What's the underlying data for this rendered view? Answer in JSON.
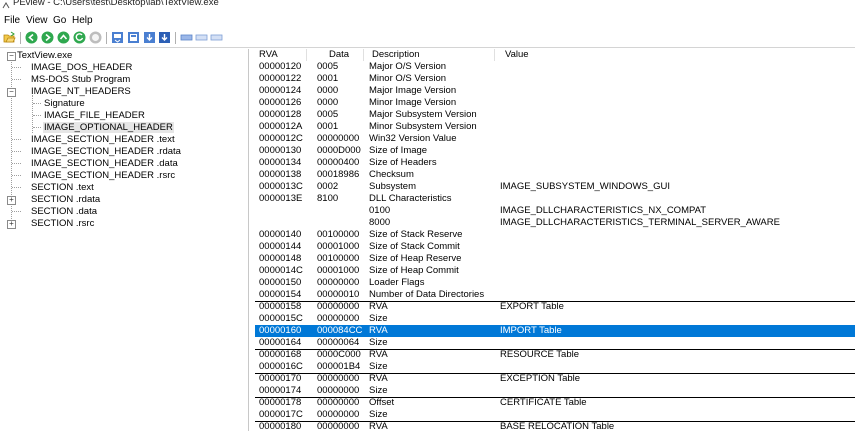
{
  "window": {
    "title": "PEview - C:\\Users\\test\\Desktop\\lab\\TextView.exe"
  },
  "menu": [
    "File",
    "View",
    "Go",
    "Help"
  ],
  "toolbar": {
    "icons": [
      "open-folder-icon",
      "back-icon",
      "forward-icon",
      "up-icon",
      "refresh-icon",
      "stop-icon",
      "view-data-icon",
      "view-hex-icon",
      "view-save-icon",
      "view-struct-icon",
      "layout-single-icon",
      "layout-double-icon",
      "layout-triple-icon"
    ]
  },
  "tree": {
    "root": "TextView.exe",
    "items": [
      {
        "label": "IMAGE_DOS_HEADER",
        "level": 1
      },
      {
        "label": "MS-DOS Stub Program",
        "level": 1
      },
      {
        "label": "IMAGE_NT_HEADERS",
        "level": 1,
        "expander": "-"
      },
      {
        "label": "Signature",
        "level": 2
      },
      {
        "label": "IMAGE_FILE_HEADER",
        "level": 2
      },
      {
        "label": "IMAGE_OPTIONAL_HEADER",
        "level": 2,
        "selected": true
      },
      {
        "label": "IMAGE_SECTION_HEADER .text",
        "level": 1
      },
      {
        "label": "IMAGE_SECTION_HEADER .rdata",
        "level": 1
      },
      {
        "label": "IMAGE_SECTION_HEADER .data",
        "level": 1
      },
      {
        "label": "IMAGE_SECTION_HEADER .rsrc",
        "level": 1
      },
      {
        "label": "SECTION .text",
        "level": 1
      },
      {
        "label": "SECTION .rdata",
        "level": 1,
        "expander": "+"
      },
      {
        "label": "SECTION .data",
        "level": 1
      },
      {
        "label": "SECTION .rsrc",
        "level": 1,
        "expander": "+"
      }
    ]
  },
  "table": {
    "headers": [
      "RVA",
      "Data",
      "Description",
      "Value"
    ],
    "rows": [
      [
        "00000120",
        "0005",
        "Major O/S Version",
        ""
      ],
      [
        "00000122",
        "0001",
        "Minor O/S Version",
        ""
      ],
      [
        "00000124",
        "0000",
        "Major Image Version",
        ""
      ],
      [
        "00000126",
        "0000",
        "Minor Image Version",
        ""
      ],
      [
        "00000128",
        "0005",
        "Major Subsystem Version",
        ""
      ],
      [
        "0000012A",
        "0001",
        "Minor Subsystem Version",
        ""
      ],
      [
        "0000012C",
        "00000000",
        "Win32 Version Value",
        ""
      ],
      [
        "00000130",
        "0000D000",
        "Size of Image",
        ""
      ],
      [
        "00000134",
        "00000400",
        "Size of Headers",
        ""
      ],
      [
        "00000138",
        "00018986",
        "Checksum",
        ""
      ],
      [
        "0000013C",
        "0002",
        "Subsystem",
        "IMAGE_SUBSYSTEM_WINDOWS_GUI"
      ],
      [
        "0000013E",
        "8100",
        "DLL Characteristics",
        ""
      ],
      [
        "",
        "",
        "0100",
        "IMAGE_DLLCHARACTERISTICS_NX_COMPAT"
      ],
      [
        "",
        "",
        "8000",
        "IMAGE_DLLCHARACTERISTICS_TERMINAL_SERVER_AWARE"
      ],
      [
        "00000140",
        "00100000",
        "Size of Stack Reserve",
        ""
      ],
      [
        "00000144",
        "00001000",
        "Size of Stack Commit",
        ""
      ],
      [
        "00000148",
        "00100000",
        "Size of Heap Reserve",
        ""
      ],
      [
        "0000014C",
        "00001000",
        "Size of Heap Commit",
        ""
      ],
      [
        "00000150",
        "00000000",
        "Loader Flags",
        ""
      ],
      [
        "00000154",
        "00000010",
        "Number of Data Directories",
        ""
      ],
      [
        "00000158",
        "00000000",
        "RVA",
        "EXPORT Table"
      ],
      [
        "0000015C",
        "00000000",
        "Size",
        ""
      ],
      [
        "00000160",
        "000084CC",
        "RVA",
        "IMPORT Table"
      ],
      [
        "00000164",
        "00000064",
        "Size",
        ""
      ],
      [
        "00000168",
        "0000C000",
        "RVA",
        "RESOURCE Table"
      ],
      [
        "0000016C",
        "000001B4",
        "Size",
        ""
      ],
      [
        "00000170",
        "00000000",
        "RVA",
        "EXCEPTION Table"
      ],
      [
        "00000174",
        "00000000",
        "Size",
        ""
      ],
      [
        "00000178",
        "00000000",
        "Offset",
        "CERTIFICATE Table"
      ],
      [
        "0000017C",
        "00000000",
        "Size",
        ""
      ],
      [
        "00000180",
        "00000000",
        "RVA",
        "BASE RELOCATION Table"
      ]
    ],
    "selected_row": 22,
    "group_start_rows": [
      20,
      22,
      24,
      26,
      28,
      30
    ]
  }
}
